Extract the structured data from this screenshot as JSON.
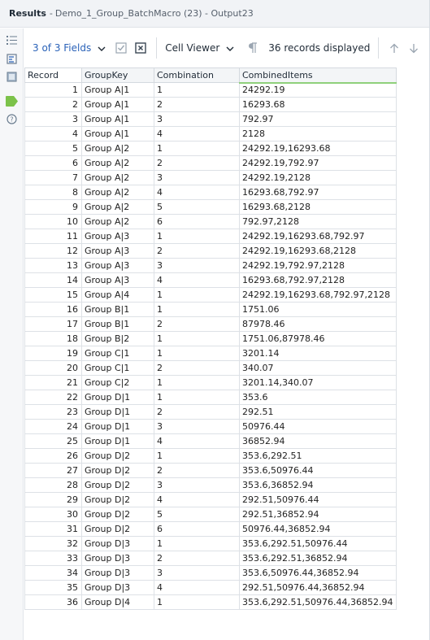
{
  "title": {
    "main": "Results",
    "separator": "-",
    "sub": "Demo_1_Group_BatchMacro (23) - Output23"
  },
  "toolbar": {
    "fields_label": "3 of 3 Fields",
    "viewer_label": "Cell Viewer",
    "records_label": "36 records displayed"
  },
  "table": {
    "headers": [
      "Record",
      "GroupKey",
      "Combination",
      "CombinedItems"
    ],
    "rows": [
      [
        "1",
        "Group A|1",
        "1",
        "24292.19"
      ],
      [
        "2",
        "Group A|1",
        "2",
        "16293.68"
      ],
      [
        "3",
        "Group A|1",
        "3",
        "792.97"
      ],
      [
        "4",
        "Group A|1",
        "4",
        "2128"
      ],
      [
        "5",
        "Group A|2",
        "1",
        "24292.19,16293.68"
      ],
      [
        "6",
        "Group A|2",
        "2",
        "24292.19,792.97"
      ],
      [
        "7",
        "Group A|2",
        "3",
        "24292.19,2128"
      ],
      [
        "8",
        "Group A|2",
        "4",
        "16293.68,792.97"
      ],
      [
        "9",
        "Group A|2",
        "5",
        "16293.68,2128"
      ],
      [
        "10",
        "Group A|2",
        "6",
        "792.97,2128"
      ],
      [
        "11",
        "Group A|3",
        "1",
        "24292.19,16293.68,792.97"
      ],
      [
        "12",
        "Group A|3",
        "2",
        "24292.19,16293.68,2128"
      ],
      [
        "13",
        "Group A|3",
        "3",
        "24292.19,792.97,2128"
      ],
      [
        "14",
        "Group A|3",
        "4",
        "16293.68,792.97,2128"
      ],
      [
        "15",
        "Group A|4",
        "1",
        "24292.19,16293.68,792.97,2128"
      ],
      [
        "16",
        "Group B|1",
        "1",
        "1751.06"
      ],
      [
        "17",
        "Group B|1",
        "2",
        "87978.46"
      ],
      [
        "18",
        "Group B|2",
        "1",
        "1751.06,87978.46"
      ],
      [
        "19",
        "Group C|1",
        "1",
        "3201.14"
      ],
      [
        "20",
        "Group C|1",
        "2",
        "340.07"
      ],
      [
        "21",
        "Group C|2",
        "1",
        "3201.14,340.07"
      ],
      [
        "22",
        "Group D|1",
        "1",
        "353.6"
      ],
      [
        "23",
        "Group D|1",
        "2",
        "292.51"
      ],
      [
        "24",
        "Group D|1",
        "3",
        "50976.44"
      ],
      [
        "25",
        "Group D|1",
        "4",
        "36852.94"
      ],
      [
        "26",
        "Group D|2",
        "1",
        "353.6,292.51"
      ],
      [
        "27",
        "Group D|2",
        "2",
        "353.6,50976.44"
      ],
      [
        "28",
        "Group D|2",
        "3",
        "353.6,36852.94"
      ],
      [
        "29",
        "Group D|2",
        "4",
        "292.51,50976.44"
      ],
      [
        "30",
        "Group D|2",
        "5",
        "292.51,36852.94"
      ],
      [
        "31",
        "Group D|2",
        "6",
        "50976.44,36852.94"
      ],
      [
        "32",
        "Group D|3",
        "1",
        "353.6,292.51,50976.44"
      ],
      [
        "33",
        "Group D|3",
        "2",
        "353.6,292.51,36852.94"
      ],
      [
        "34",
        "Group D|3",
        "3",
        "353.6,50976.44,36852.94"
      ],
      [
        "35",
        "Group D|3",
        "4",
        "292.51,50976.44,36852.94"
      ],
      [
        "36",
        "Group D|4",
        "1",
        "353.6,292.51,50976.44,36852.94"
      ]
    ]
  },
  "icons": {
    "rail": [
      "list-icon",
      "input-data-icon",
      "output-data-icon",
      "tag-icon",
      "help-icon"
    ],
    "toolbar": [
      "chevron-down-icon",
      "checkbox-icon",
      "deselect-icon",
      "pilcrow-icon",
      "arrow-up-icon",
      "arrow-down-icon"
    ]
  },
  "colors": {
    "accent": "#2a62b8",
    "header_highlight": "#8fd07b",
    "tag_green": "#7cc24a"
  }
}
